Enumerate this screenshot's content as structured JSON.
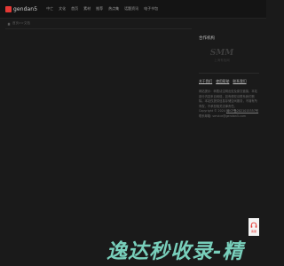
{
  "header": {
    "logo_text": "gendan5",
    "nav": [
      "中亡",
      "文化",
      "首页",
      "素材",
      "推荐",
      "热点集",
      "话题资讯",
      "电子书包"
    ]
  },
  "breadcrumb": {
    "label": "首页>>文档"
  },
  "sidebar": {
    "partner_title": "合作机构",
    "partner_logo_mark": "SMM",
    "partner_logo_sub": "上海有色网",
    "links": [
      "关于我们",
      "使用帮助",
      "联系我们"
    ],
    "disclaimer": "网站提示：转载请注明出处及原文链接，本站部分内容来自网络，如有侵权请联系我们删除。本站仅提供信息存储空间服务，不拥有所有权，不承担相关法律责任。",
    "copyright_prefix": "Copyright © 2024",
    "icp_link": "闽ICP备2021015357号",
    "copyright_suffix": "联系邮箱: service@gendan5.com"
  },
  "float_button": {
    "label": "客服"
  },
  "watermark": {
    "text": "逸达秒收录-精"
  }
}
